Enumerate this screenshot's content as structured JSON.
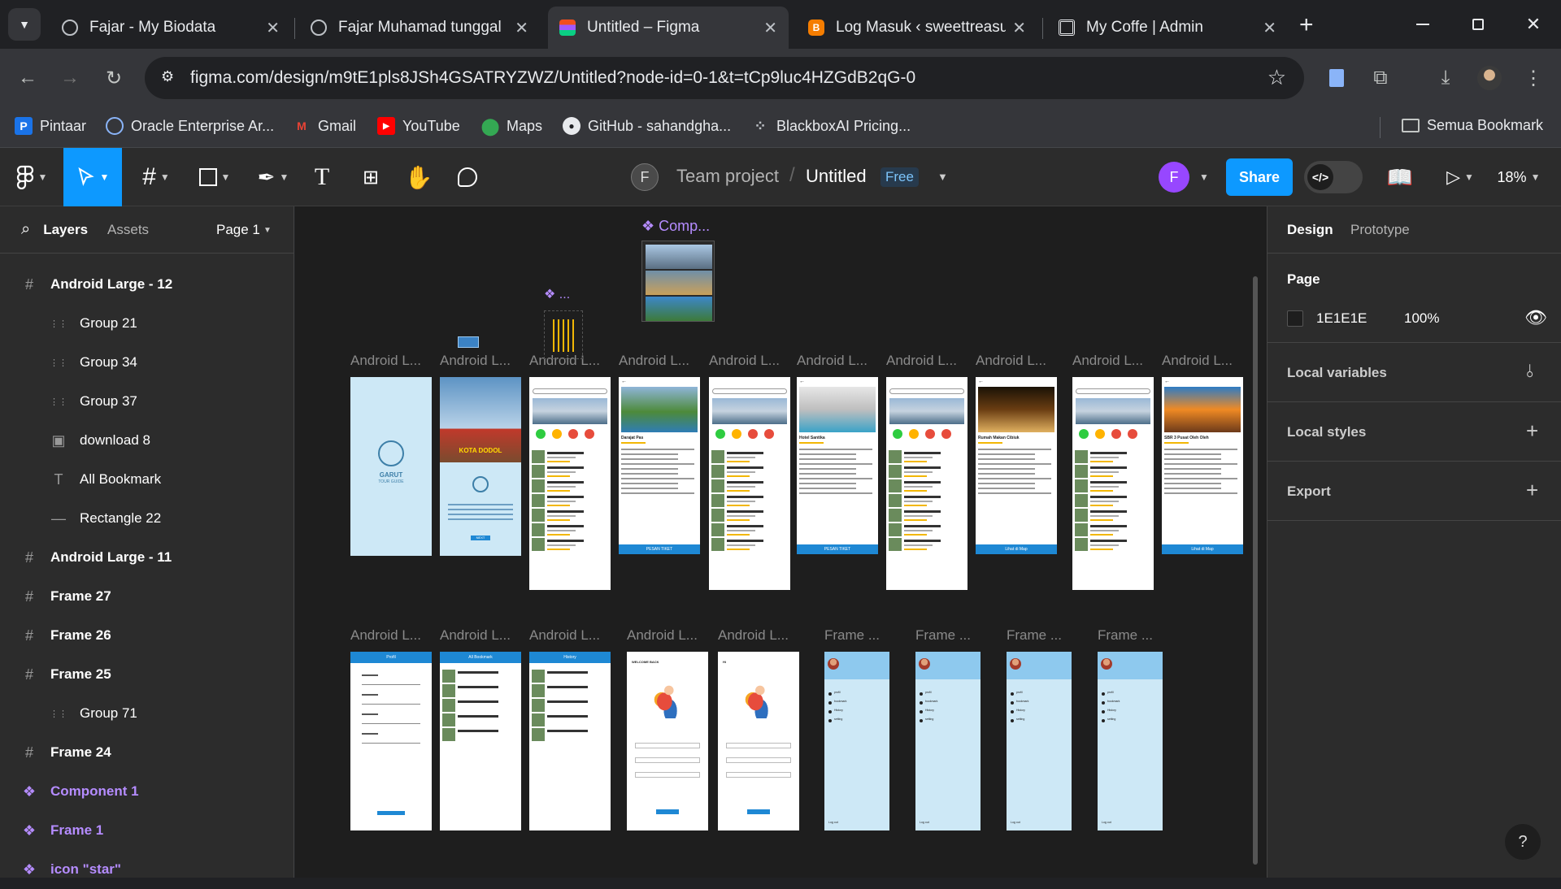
{
  "tabs": [
    {
      "title": "Fajar - My Biodata",
      "icon": "globe-icon"
    },
    {
      "title": "Fajar Muhamad tunggal",
      "icon": "globe-icon"
    },
    {
      "title": "Untitled – Figma",
      "icon": "figma-icon",
      "active": true
    },
    {
      "title": "Log Masuk ‹ sweettreasur",
      "icon": "blogger-icon"
    },
    {
      "title": "My Coffe | Admin",
      "icon": "qr-icon"
    }
  ],
  "address": {
    "url": "figma.com/design/m9tE1pls8JSh4GSATRYZWZ/Untitled?node-id=0-1&t=tCp9luc4HZGdB2qG-0"
  },
  "bookmarks": [
    {
      "label": "Pintaar",
      "icon": "pintaar-icon"
    },
    {
      "label": "Oracle Enterprise Ar...",
      "icon": "oracle-icon"
    },
    {
      "label": "Gmail",
      "icon": "gmail-icon"
    },
    {
      "label": "YouTube",
      "icon": "youtube-icon"
    },
    {
      "label": "Maps",
      "icon": "maps-icon"
    },
    {
      "label": "GitHub - sahandgha...",
      "icon": "github-icon"
    },
    {
      "label": "BlackboxAI Pricing...",
      "icon": "blackbox-icon"
    }
  ],
  "bookmarks_all": "Semua Bookmark",
  "figma": {
    "team_initial": "F",
    "team": "Team project",
    "file": "Untitled",
    "plan": "Free",
    "user_initial": "F",
    "share": "Share",
    "zoom": "18%",
    "code_label": "</>"
  },
  "left_panel": {
    "tab_layers": "Layers",
    "tab_assets": "Assets",
    "page": "Page 1",
    "layers": [
      {
        "label": "Android Large - 12",
        "type": "frame",
        "indent": 0
      },
      {
        "label": "Group 21",
        "type": "group",
        "indent": 1
      },
      {
        "label": "Group 34",
        "type": "group",
        "indent": 1
      },
      {
        "label": "Group 37",
        "type": "group",
        "indent": 1
      },
      {
        "label": "download 8",
        "type": "image",
        "indent": 1
      },
      {
        "label": "All Bookmark",
        "type": "text",
        "indent": 1
      },
      {
        "label": "Rectangle 22",
        "type": "rect",
        "indent": 1
      },
      {
        "label": "Android Large - 11",
        "type": "frame",
        "indent": 0
      },
      {
        "label": "Frame 27",
        "type": "frame",
        "indent": 0
      },
      {
        "label": "Frame 26",
        "type": "frame",
        "indent": 0
      },
      {
        "label": "Frame 25",
        "type": "frame",
        "indent": 0
      },
      {
        "label": "Group 71",
        "type": "group",
        "indent": 1
      },
      {
        "label": "Frame 24",
        "type": "frame",
        "indent": 0
      },
      {
        "label": "Component 1",
        "type": "component",
        "indent": 0
      },
      {
        "label": "Frame 1",
        "type": "component",
        "indent": 0
      },
      {
        "label": "icon \"star\"",
        "type": "component",
        "indent": 0
      }
    ]
  },
  "canvas": {
    "component_label": "Comp...",
    "dots_label": "...",
    "frame_labels_row1": [
      "Android L...",
      "Android L...",
      "Android L...",
      "Android L...",
      "Android L...",
      "Android L...",
      "Android L...",
      "Android L...",
      "Android L...",
      "Android L..."
    ],
    "frame_labels_row2": [
      "Android L...",
      "Android L...",
      "Android L...",
      "Android L...",
      "Android L...",
      "Frame ...",
      "Frame ...",
      "Frame ...",
      "Frame ..."
    ],
    "row1_types": [
      "splash",
      "city",
      "list",
      "detail",
      "list",
      "detail",
      "list",
      "detail",
      "list",
      "detail"
    ],
    "row2_types": [
      "profile",
      "list",
      "list",
      "login",
      "login",
      "menu",
      "menu",
      "menu",
      "menu"
    ],
    "splash_brand": "GARUT",
    "splash_sub": "TOUR GUIDE",
    "city_banner": "KOTA DODOL",
    "city_next": "NEXT",
    "detail_titles": [
      "Darajat Pas",
      "Hotel Santika",
      "Rumah Makan Cibiuk",
      "SBR 3 Pusat Oleh Oleh"
    ],
    "detail_buttons": [
      "PESAN TIKET",
      "PESAN TIKET",
      "Lihat di Map",
      "Lihat di Map"
    ],
    "profile_title": "Profil",
    "bookmark_title": "All Bookmark",
    "history_title": "History",
    "login_titles": [
      "WELCOME BACK",
      "Hi"
    ],
    "menu_items": [
      "profil",
      "bookmark",
      "History",
      "setting"
    ],
    "logout": "Log out"
  },
  "right_panel": {
    "tab_design": "Design",
    "tab_prototype": "Prototype",
    "page_title": "Page",
    "page_color": "1E1E1E",
    "page_opacity": "100%",
    "page_swatch": "#1e1e1e",
    "local_variables": "Local variables",
    "local_styles": "Local styles",
    "export": "Export"
  },
  "colors": {
    "accent": "#0d99ff",
    "component": "#b58cff",
    "app_blue": "#1e88d4",
    "light_blue": "#cde8f6"
  }
}
